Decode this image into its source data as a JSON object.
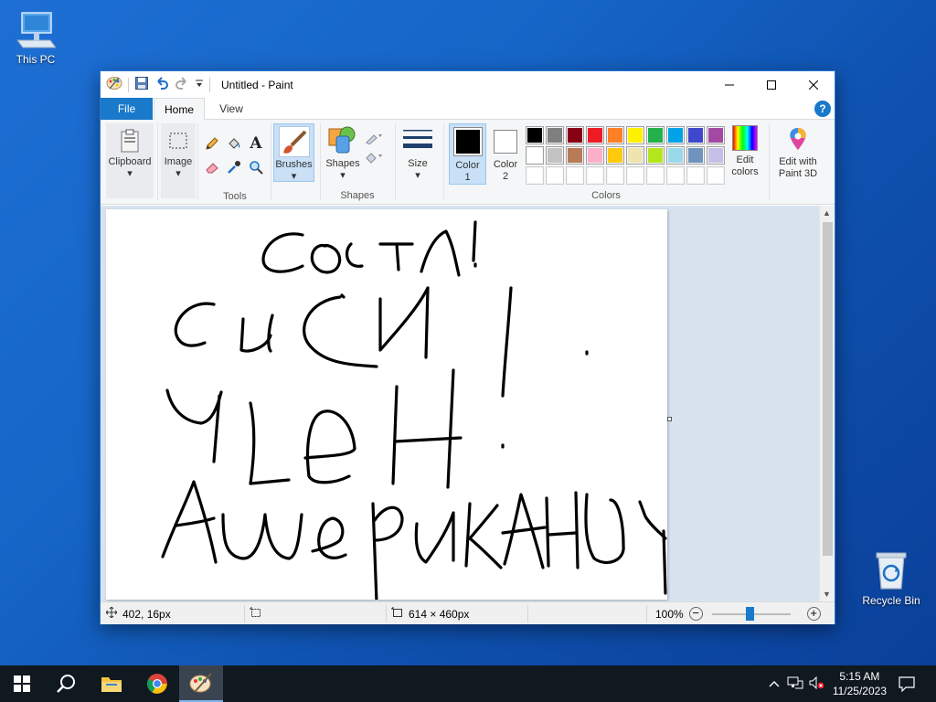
{
  "desktop": {
    "icons": [
      {
        "label": "This PC"
      },
      {
        "label": "Recycle Bin"
      }
    ]
  },
  "window": {
    "title": "Untitled - Paint",
    "tabs": {
      "file": "File",
      "home": "Home",
      "view": "View"
    },
    "help": "?",
    "ribbon": {
      "clipboard": "Clipboard",
      "image": "Image",
      "tools_label": "Tools",
      "brushes": "Brushes",
      "shapes": "Shapes",
      "shapes_group": "Shapes",
      "size": "Size",
      "color1_a": "Color",
      "color1_b": "1",
      "color2_a": "Color",
      "color2_b": "2",
      "edit_colors_a": "Edit",
      "edit_colors_b": "colors",
      "paint3d_a": "Edit with",
      "paint3d_b": "Paint 3D",
      "colors_label": "Colors",
      "palette_row1": [
        "#000000",
        "#7f7f7f",
        "#880015",
        "#ed1c24",
        "#ff7f27",
        "#fff200",
        "#22b14c",
        "#00a2e8",
        "#3f48cc",
        "#a349a4"
      ],
      "palette_row2": [
        "#ffffff",
        "#c3c3c3",
        "#b97a57",
        "#ffaec9",
        "#ffc90e",
        "#efe4b0",
        "#b5e61d",
        "#99d9ea",
        "#7092be",
        "#c8bfe7"
      ],
      "palette_row3": [
        "#ffffff",
        "#ffffff",
        "#ffffff",
        "#ffffff",
        "#ffffff",
        "#ffffff",
        "#ffffff",
        "#ffffff",
        "#ffffff",
        "#ffffff"
      ],
      "color1": "#000000",
      "color2": "#ffffff"
    },
    "status": {
      "cursor_pos": "402, 16px",
      "image_size": "614 × 460px",
      "zoom": "100%"
    }
  },
  "taskbar": {
    "time": "5:15 AM",
    "date": "11/25/2023"
  }
}
